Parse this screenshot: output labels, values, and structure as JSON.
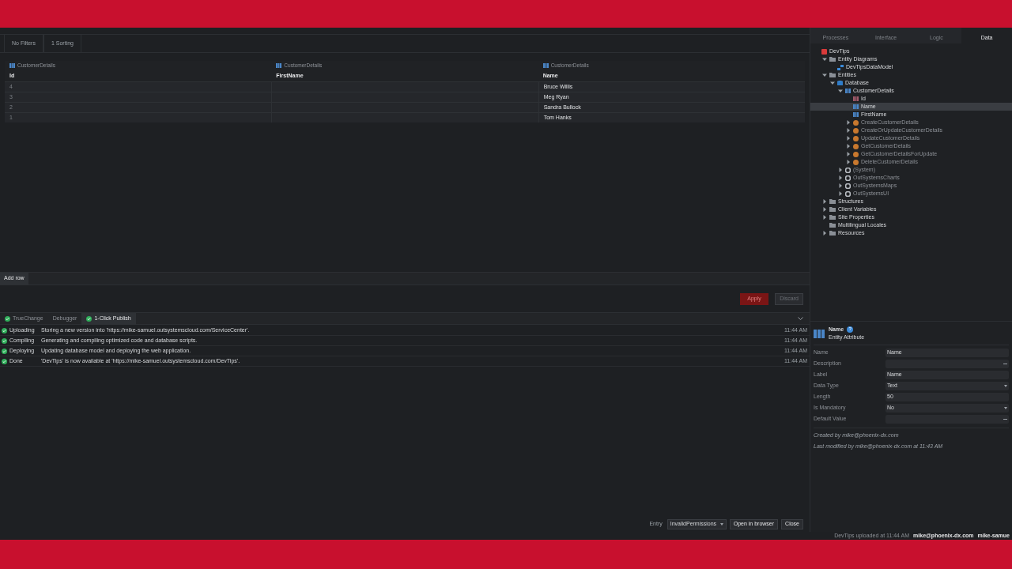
{
  "filters": [
    {
      "label": "No Filters"
    },
    {
      "label": "1 Sorting"
    }
  ],
  "table": {
    "columns": [
      {
        "entity": "CustomerDetails",
        "name": "Id"
      },
      {
        "entity": "CustomerDetails",
        "name": "FirstName"
      },
      {
        "entity": "CustomerDetails",
        "name": "Name"
      }
    ],
    "rows": [
      [
        "4",
        "",
        "Bruce Willis"
      ],
      [
        "3",
        "",
        "Meg Ryan"
      ],
      [
        "2",
        "",
        "Sandra Bullock"
      ],
      [
        "1",
        "",
        "Tom Hanks"
      ]
    ]
  },
  "add_row": "Add row",
  "actions": [
    {
      "label": "Apply",
      "disabled": false,
      "kind": "primary"
    },
    {
      "label": "Discard",
      "disabled": true,
      "kind": "secondary"
    }
  ],
  "bottom_tabs": [
    {
      "label": "TrueChange",
      "selected": false,
      "status": true
    },
    {
      "label": "Debugger",
      "selected": false,
      "status": false
    },
    {
      "label": "1-Click Publish",
      "selected": true,
      "status": true
    }
  ],
  "log": [
    {
      "step": "Uploading",
      "message": "Storing a new version into 'https://mike-samuel.outsystemscloud.com/ServiceCenter'.",
      "time": "11:44 AM"
    },
    {
      "step": "Compiling",
      "message": "Generating and compiling optimized code and database scripts.",
      "time": "11:44 AM"
    },
    {
      "step": "Deploying",
      "message": "Updating database model and deploying the web application.",
      "time": "11:44 AM"
    },
    {
      "step": "Done",
      "message": "'DevTips' is now available at 'https://mike-samuel.outsystemscloud.com/DevTips'.",
      "time": "11:44 AM"
    }
  ],
  "footer": {
    "entry_label": "Entry",
    "entry_value": "InvalidPermissions",
    "buttons": [
      "Open in browser",
      "Close"
    ]
  },
  "status_bar": {
    "text": "DevTips uploaded at 11:44 AM",
    "user": "mike@phoenix-dx.com",
    "account": "mike-samue"
  },
  "layer_tabs": [
    {
      "label": "Processes",
      "selected": false
    },
    {
      "label": "Interface",
      "selected": false
    },
    {
      "label": "Logic",
      "selected": false
    },
    {
      "label": "Data",
      "selected": true
    }
  ],
  "tree": [
    {
      "label": "DevTips",
      "kind": "module",
      "selected": false,
      "children": [
        {
          "label": "Entity Diagrams",
          "kind": "folder",
          "expanded": true,
          "selected": false,
          "children": [
            {
              "label": "DevTipsDataModel",
              "kind": "diagram",
              "selected": false
            }
          ]
        },
        {
          "label": "Entities",
          "kind": "folder",
          "expanded": true,
          "selected": false,
          "children": [
            {
              "label": "Database",
              "kind": "database",
              "expanded": true,
              "selected": false,
              "children": [
                {
                  "label": "CustomerDetails",
                  "kind": "entity",
                  "expanded": true,
                  "selected": false,
                  "children": [
                    {
                      "label": "Id",
                      "kind": "key",
                      "selected": false
                    },
                    {
                      "label": "Name",
                      "kind": "attribute",
                      "selected": true
                    },
                    {
                      "label": "FirstName",
                      "kind": "attribute",
                      "selected": false
                    },
                    {
                      "label": "CreateCustomerDetails",
                      "kind": "action",
                      "expanded": false,
                      "selected": false
                    },
                    {
                      "label": "CreateOrUpdateCustomerDetails",
                      "kind": "action",
                      "expanded": false,
                      "selected": false
                    },
                    {
                      "label": "UpdateCustomerDetails",
                      "kind": "action",
                      "expanded": false,
                      "selected": false
                    },
                    {
                      "label": "GetCustomerDetails",
                      "kind": "action",
                      "expanded": false,
                      "selected": false
                    },
                    {
                      "label": "GetCustomerDetailsForUpdate",
                      "kind": "action",
                      "expanded": false,
                      "selected": false
                    },
                    {
                      "label": "DeleteCustomerDetails",
                      "kind": "action",
                      "expanded": false,
                      "selected": false
                    }
                  ]
                },
                {
                  "label": "(System)",
                  "kind": "gear",
                  "expanded": false,
                  "selected": false
                },
                {
                  "label": "OutSystemsCharts",
                  "kind": "gear",
                  "expanded": false,
                  "selected": false
                },
                {
                  "label": "OutSystemsMaps",
                  "kind": "gear",
                  "expanded": false,
                  "selected": false
                },
                {
                  "label": "OutSystemsUI",
                  "kind": "gear",
                  "expanded": false,
                  "selected": false
                }
              ]
            }
          ]
        },
        {
          "label": "Structures",
          "kind": "folder",
          "expanded": false,
          "selected": false
        },
        {
          "label": "Client Variables",
          "kind": "folder",
          "expanded": false,
          "selected": false
        },
        {
          "label": "Site Properties",
          "kind": "folder",
          "expanded": false,
          "selected": false
        },
        {
          "label": "Multilingual Locales",
          "kind": "folder",
          "selected": false
        },
        {
          "label": "Resources",
          "kind": "folder",
          "expanded": false,
          "selected": false
        }
      ]
    }
  ],
  "properties": {
    "title": "Name",
    "subtitle": "Entity Attribute",
    "help": "?",
    "fields": [
      {
        "label": "Name",
        "value": "Name",
        "kind": "text"
      },
      {
        "label": "Description",
        "kind": "ellipsis"
      },
      {
        "label": "Label",
        "value": "Name",
        "kind": "text"
      },
      {
        "label": "Data Type",
        "value": "Text",
        "kind": "dropdown"
      },
      {
        "label": "Length",
        "value": "50",
        "kind": "text"
      },
      {
        "label": "Is Mandatory",
        "value": "No",
        "kind": "dropdown"
      },
      {
        "label": "Default Value",
        "kind": "ellipsis"
      }
    ],
    "created": "Created by mike@phoenix-dx.com",
    "modified": "Last modified by mike@phoenix-dx.com at 11:43 AM"
  }
}
